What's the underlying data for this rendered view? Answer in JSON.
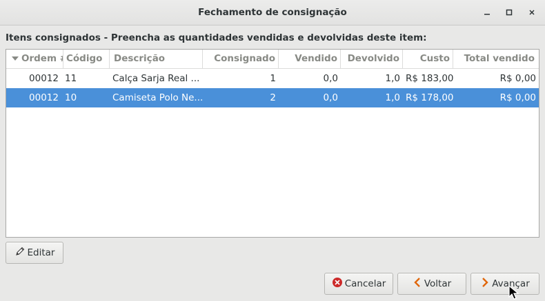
{
  "window": {
    "title": "Fechamento de consignação",
    "minimize": "–",
    "maximize": "□",
    "close": "×"
  },
  "instruction": "Itens consignados - Preencha as quantidades vendidas e devolvidas deste item:",
  "table": {
    "columns": [
      "Ordem #",
      "Código",
      "Descrição",
      "Consignado",
      "Vendido",
      "Devolvido",
      "Custo",
      "Total vendido"
    ],
    "rows": [
      {
        "ordem": "00012",
        "codigo": "11",
        "descricao": "Calça Sarja Real ...",
        "consignado": "1",
        "vendido": "0,0",
        "devolvido": "1,0",
        "custo": "R$ 183,00",
        "total": "R$ 0,00",
        "selected": false
      },
      {
        "ordem": "00012",
        "codigo": "10",
        "descricao": "Camiseta Polo Ne...",
        "consignado": "2",
        "vendido": "0,0",
        "devolvido": "1,0",
        "custo": "R$ 178,00",
        "total": "R$ 0,00",
        "selected": true
      }
    ]
  },
  "buttons": {
    "edit": "Editar",
    "cancel": "Cancelar",
    "back": "Voltar",
    "next": "Avançar"
  },
  "colors": {
    "selection": "#4a90d9",
    "cancel_icon": "#cc2929",
    "nav_icon": "#e0660a"
  }
}
